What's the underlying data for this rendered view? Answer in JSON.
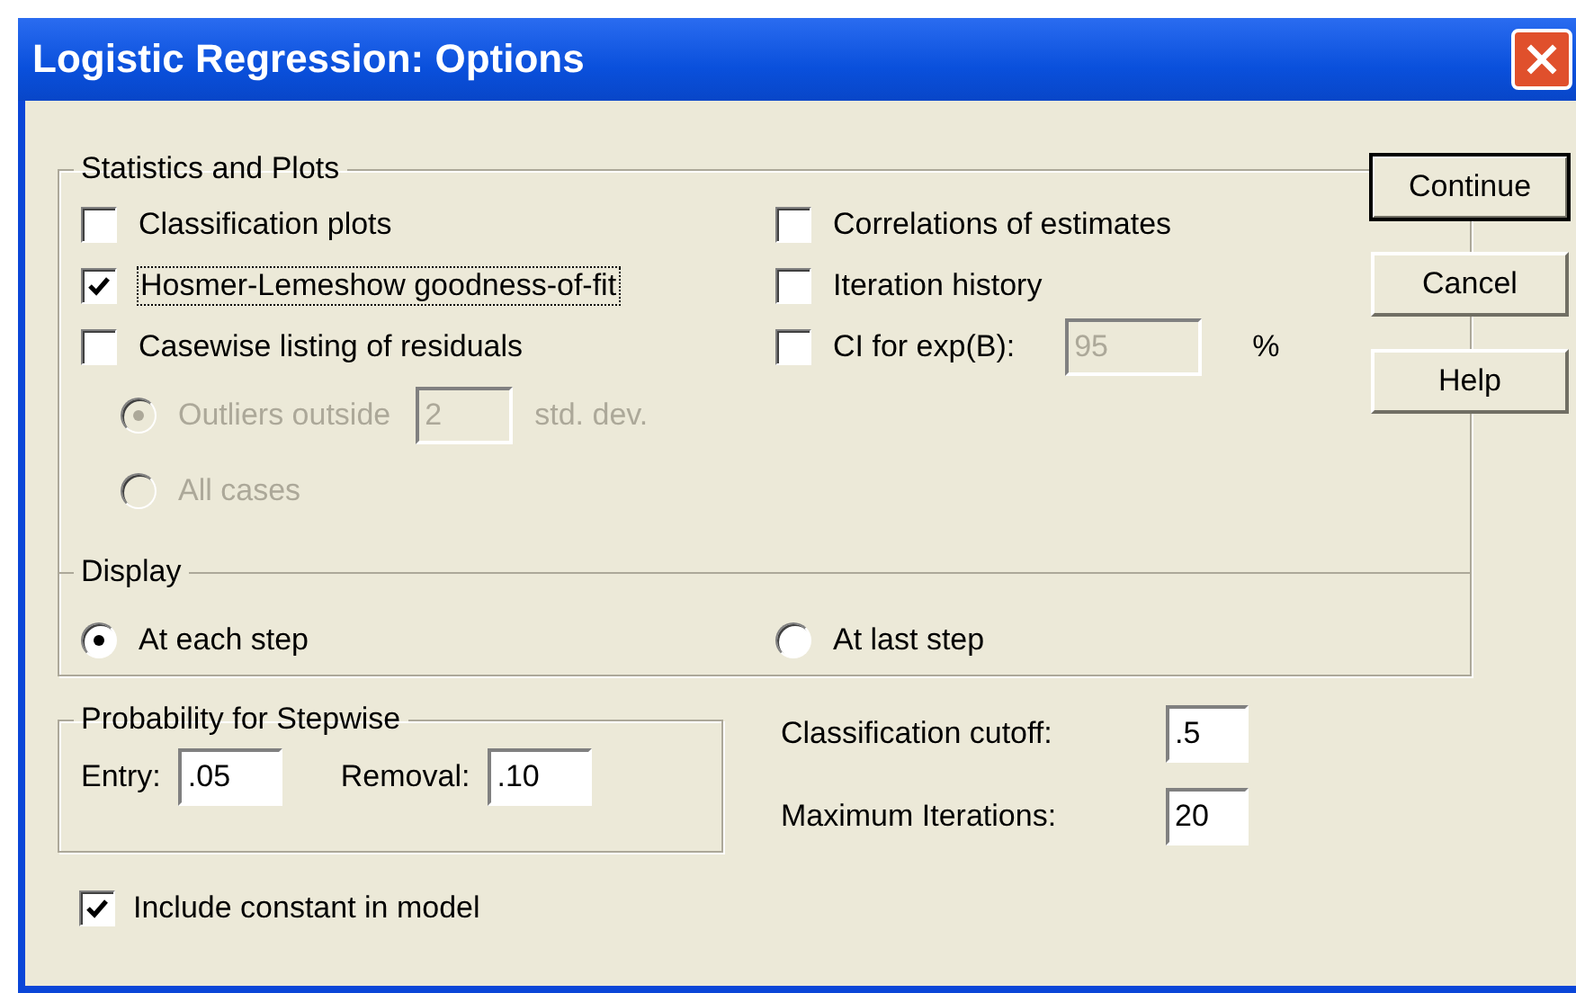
{
  "window": {
    "title": "Logistic Regression: Options"
  },
  "statistics_and_plots": {
    "title": "Statistics and Plots",
    "left_options": [
      {
        "label": "Classification plots",
        "checked": false,
        "focused": false
      },
      {
        "label": "Hosmer-Lemeshow goodness-of-fit",
        "checked": true,
        "focused": true
      },
      {
        "label": "Casewise listing of residuals",
        "checked": false,
        "focused": false
      }
    ],
    "casewise_options": [
      {
        "kind": "threshold",
        "label": "Outliers outside",
        "value": "2",
        "unit": "std. dev.",
        "selected": true,
        "disabled": true
      },
      {
        "kind": "plain",
        "label": "All cases",
        "selected": false,
        "disabled": true
      }
    ],
    "right_options": [
      {
        "kind": "plain",
        "label": "Correlations of estimates",
        "checked": false
      },
      {
        "kind": "plain",
        "label": "Iteration history",
        "checked": false
      },
      {
        "kind": "field",
        "label": "CI for exp(B):",
        "checked": false,
        "value": "95",
        "disabled": true,
        "unit": "%"
      }
    ]
  },
  "display": {
    "title": "Display",
    "options": [
      {
        "label": "At each step",
        "selected": true
      },
      {
        "label": "At last step",
        "selected": false
      }
    ]
  },
  "probability_for_stepwise": {
    "title": "Probability for Stepwise",
    "fields": [
      {
        "label": "Entry:",
        "value": ".05"
      },
      {
        "label": "Removal:",
        "value": ".10"
      }
    ]
  },
  "model_fields": [
    {
      "label": "Classification cutoff:",
      "value": ".5"
    },
    {
      "label": "Maximum Iterations:",
      "value": "20"
    }
  ],
  "include_constant": {
    "label": "Include constant in model",
    "checked": true
  },
  "buttons": [
    {
      "label": "Continue",
      "default": true
    },
    {
      "label": "Cancel",
      "default": false
    },
    {
      "label": "Help",
      "default": false
    }
  ]
}
